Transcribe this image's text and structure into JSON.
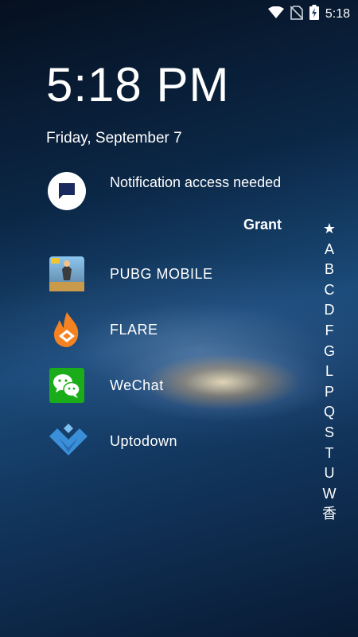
{
  "status_bar": {
    "time": "5:18",
    "icons": [
      "wifi-icon",
      "no-sim-icon",
      "battery-charging-icon"
    ]
  },
  "lock": {
    "time": "5:18 PM",
    "date": "Friday, September 7"
  },
  "notification": {
    "title": "Notification access needed",
    "action": "Grant",
    "icon": "message-icon"
  },
  "apps": [
    {
      "label": "PUBG MOBILE",
      "icon": "pubg-icon"
    },
    {
      "label": "FLARE",
      "icon": "flame-icon"
    },
    {
      "label": "WeChat",
      "icon": "wechat-icon"
    },
    {
      "label": "Uptodown",
      "icon": "uptodown-icon"
    }
  ],
  "index": [
    "★",
    "A",
    "B",
    "C",
    "D",
    "F",
    "G",
    "L",
    "P",
    "Q",
    "S",
    "T",
    "U",
    "W",
    "香"
  ],
  "colors": {
    "wechat_green": "#1AAD19",
    "uptodown_blue": "#3a8fd8",
    "flare_orange": "#f58220",
    "notif_icon": "#1b2a5e"
  }
}
